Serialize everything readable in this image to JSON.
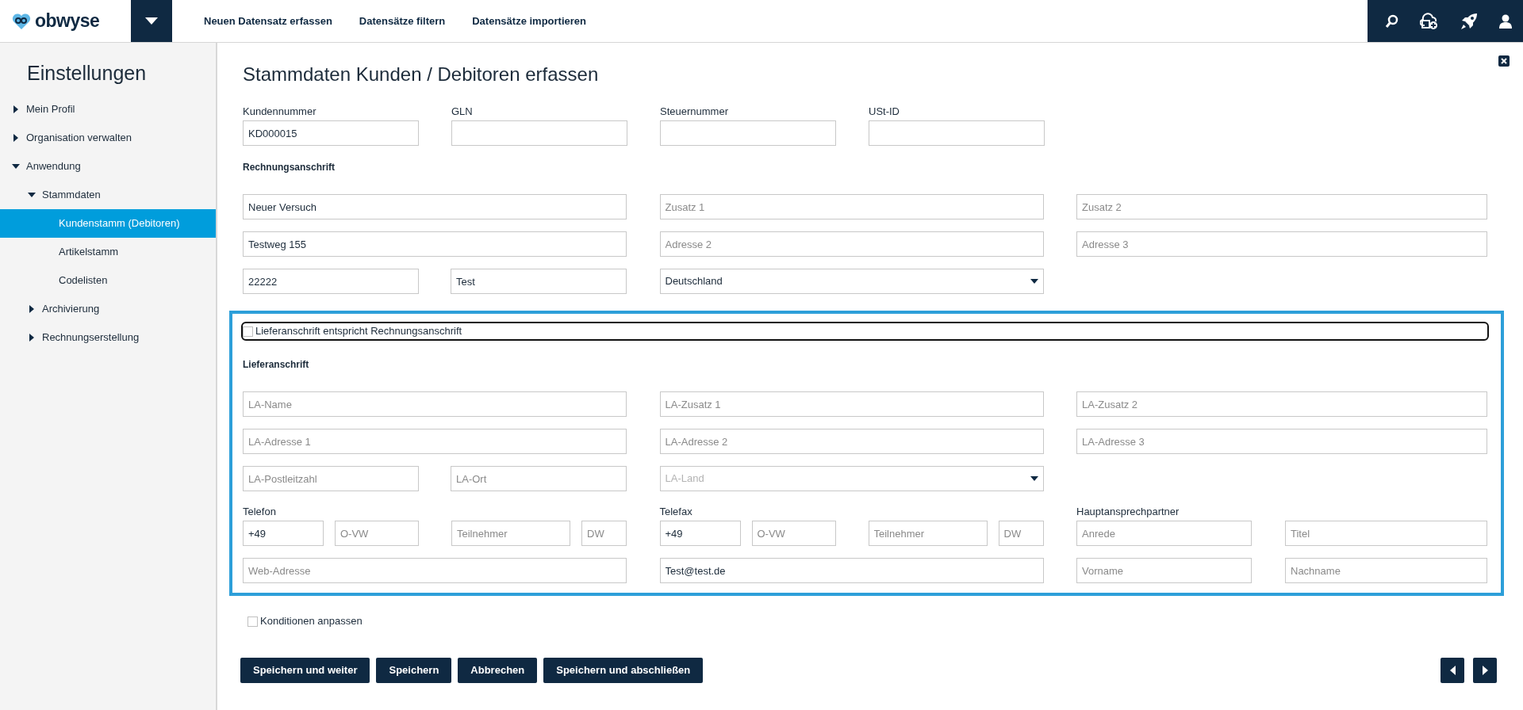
{
  "app": {
    "logo": "obwyse"
  },
  "topnav": {
    "links": [
      "Neuen Datensatz erfassen",
      "Datensätze filtern",
      "Datensätze importieren"
    ]
  },
  "sidebar": {
    "title": "Einstellungen",
    "items": [
      {
        "label": "Mein Profil",
        "expanded": false,
        "selected": false
      },
      {
        "label": "Organisation verwalten",
        "expanded": false,
        "selected": false
      },
      {
        "label": "Anwendung",
        "expanded": true,
        "selected": false,
        "children": [
          {
            "label": "Stammdaten",
            "expanded": true,
            "selected": false,
            "children": [
              {
                "label": "Kundenstamm (Debitoren)",
                "selected": true
              },
              {
                "label": "Artikelstamm",
                "selected": false
              },
              {
                "label": "Codelisten",
                "selected": false
              }
            ]
          },
          {
            "label": "Archivierung",
            "expanded": false,
            "selected": false
          },
          {
            "label": "Rechnungserstellung",
            "expanded": false,
            "selected": false
          }
        ]
      }
    ]
  },
  "form": {
    "title": "Stammdaten Kunden / Debitoren erfassen",
    "id_fields": [
      {
        "label": "Kundennummer",
        "value": "KD000015"
      },
      {
        "label": "GLN"
      },
      {
        "label": "Steuernummer"
      },
      {
        "label": "USt-ID"
      }
    ],
    "billing": {
      "heading": "Rechnungsanschrift",
      "name": {
        "value": "Neuer Versuch"
      },
      "addition_1": {
        "placeholder": "Zusatz 1"
      },
      "addition_2": {
        "placeholder": "Zusatz 2"
      },
      "address_1": {
        "value": "Testweg 155"
      },
      "address_2": {
        "placeholder": "Adresse 2"
      },
      "address_3": {
        "placeholder": "Adresse 3"
      },
      "postcode": {
        "value": "22222"
      },
      "city": {
        "value": "Test"
      },
      "country": {
        "value": "Deutschland"
      }
    },
    "same_address": {
      "label": "Lieferanschrift entspricht Rechnungsanschrift",
      "checked": false,
      "focused": true
    },
    "delivery": {
      "heading": "Lieferanschrift",
      "name": {
        "placeholder": "LA-Name"
      },
      "addition_1": {
        "placeholder": "LA-Zusatz 1"
      },
      "addition_2": {
        "placeholder": "LA-Zusatz 2"
      },
      "address_1": {
        "placeholder": "LA-Adresse 1"
      },
      "address_2": {
        "placeholder": "LA-Adresse 2"
      },
      "address_3": {
        "placeholder": "LA-Adresse 3"
      },
      "postcode": {
        "placeholder": "LA-Postleitzahl"
      },
      "city": {
        "placeholder": "LA-Ort"
      },
      "country": {
        "placeholder": "LA-Land"
      }
    },
    "phone": {
      "label": "Telefon",
      "fields": [
        {
          "value": "+49"
        },
        {
          "placeholder": "O-VW"
        },
        {
          "placeholder": "Teilnehmer"
        },
        {
          "placeholder": "DW"
        }
      ]
    },
    "fax": {
      "label": "Telefax",
      "fields": [
        {
          "value": "+49"
        },
        {
          "placeholder": "O-VW"
        },
        {
          "placeholder": "Teilnehmer"
        },
        {
          "placeholder": "DW"
        }
      ]
    },
    "contact": {
      "label": "Hauptansprechpartner",
      "salutation": {
        "placeholder": "Anrede"
      },
      "title": {
        "placeholder": "Titel"
      },
      "first_name": {
        "placeholder": "Vorname"
      },
      "last_name": {
        "placeholder": "Nachname"
      }
    },
    "web": {
      "placeholder": "Web-Adresse"
    },
    "email": {
      "value": "Test@test.de"
    },
    "conditions": {
      "label": "Konditionen anpassen",
      "checked": false
    },
    "buttons": [
      "Speichern und weiter",
      "Speichern",
      "Abbrechen",
      "Speichern und abschließen"
    ]
  }
}
